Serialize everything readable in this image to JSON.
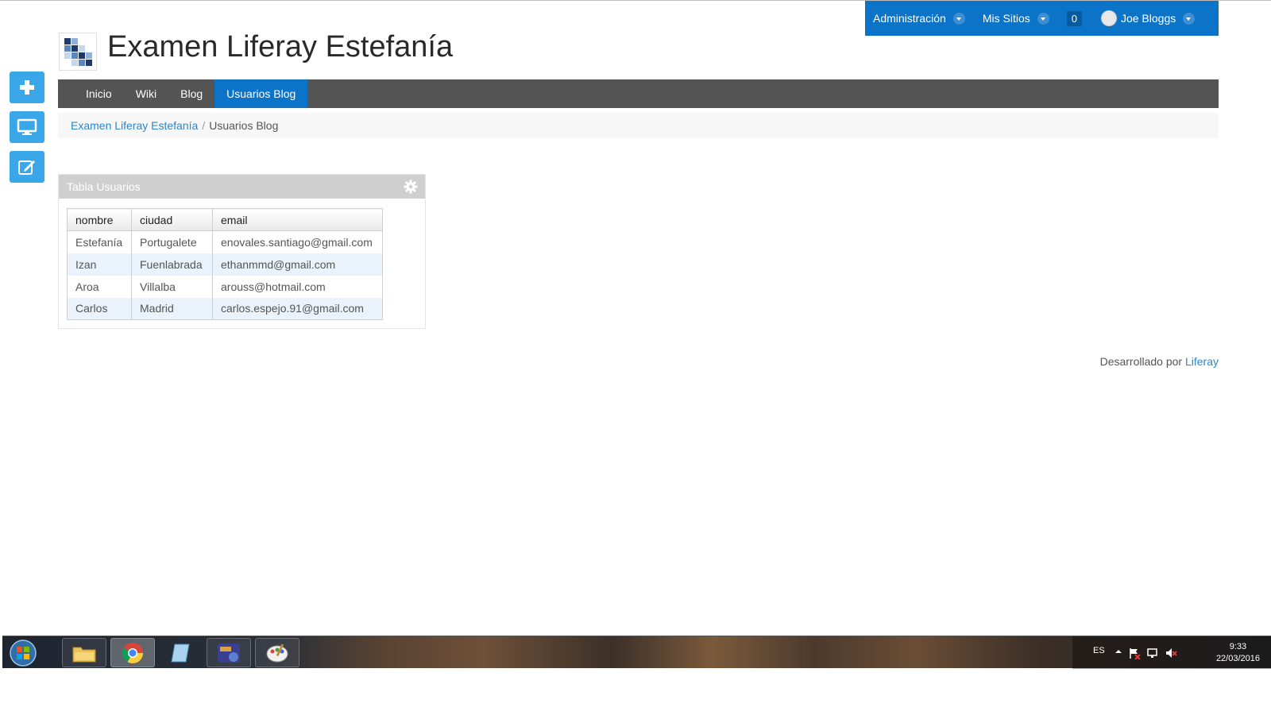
{
  "dockbar": {
    "admin_label": "Administración",
    "sites_label": "Mis Sitios",
    "notifications_count": "0",
    "user_name": "Joe Bloggs"
  },
  "header": {
    "site_title": "Examen Liferay Estefanía"
  },
  "nav": {
    "items": [
      {
        "label": "Inicio"
      },
      {
        "label": "Wiki"
      },
      {
        "label": "Blog"
      },
      {
        "label": "Usuarios Blog"
      }
    ],
    "active_index": 3
  },
  "breadcrumb": {
    "root": "Examen Liferay Estefanía",
    "separator": "/",
    "current": "Usuarios Blog"
  },
  "portlet": {
    "title": "Tabla Usuarios",
    "columns": [
      "nombre",
      "ciudad",
      "email"
    ],
    "rows": [
      [
        "Estefanía",
        "Portugalete",
        "enovales.santiago@gmail.com"
      ],
      [
        "Izan",
        "Fuenlabrada",
        "ethanmmd@gmail.com"
      ],
      [
        "Aroa",
        "Villalba",
        "arouss@hotmail.com"
      ],
      [
        "Carlos",
        "Madrid",
        "carlos.espejo.91@gmail.com"
      ]
    ]
  },
  "footer": {
    "text": "Desarrollado por",
    "link": "Liferay"
  },
  "taskbar": {
    "lang": "ES",
    "time": "9:33",
    "date": "22/03/2016"
  },
  "colors": {
    "accent": "#0b74c9",
    "side_button": "#3aa7e8",
    "navbar": "#545454",
    "link": "#2b86c6"
  }
}
